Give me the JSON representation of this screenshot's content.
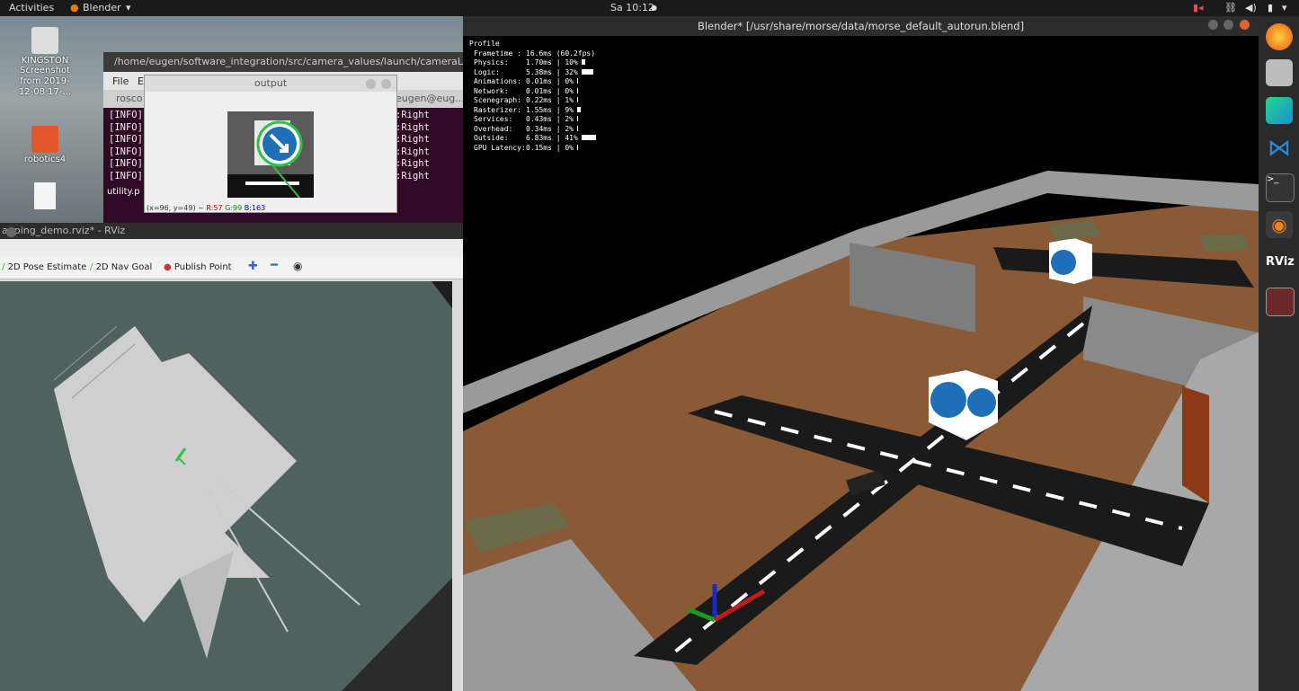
{
  "topbar": {
    "activities": "Activities",
    "app_name": "Blender",
    "clock": "Sa 10:12"
  },
  "desktop": {
    "icons": [
      {
        "label": "KINGSTON"
      },
      {
        "label": "Screenshot from 2019-12-08 17-..."
      },
      {
        "label": "robotics4"
      }
    ]
  },
  "terminal": {
    "title": "/home/eugen/software_integration/src/camera_values/launch/cameraL.l",
    "menu_file": "File",
    "menu_edit": "E",
    "tab_left": "rosco",
    "tab_right": "eugen@eug...",
    "behind_label": "utility.p",
    "log_prefix": [
      "[INFO]",
      "[INFO]",
      "[INFO]",
      "[INFO]",
      "[INFO]",
      "[INFO]"
    ],
    "log_suffix": [
      ":Right",
      ":Right",
      ":Right",
      ":Right",
      ":Right",
      ":Right"
    ]
  },
  "output_window": {
    "title": "output",
    "pixel_info_prefix": "(x=96, y=49) ~ ",
    "pixel_r": "R:57",
    "pixel_g": "G:99",
    "pixel_b": "B:163"
  },
  "rviz": {
    "title": "apping_demo.rviz* - RViz",
    "tools": [
      {
        "label": "2D Pose Estimate"
      },
      {
        "label": "2D Nav Goal"
      },
      {
        "label": "Publish Point"
      }
    ]
  },
  "blender": {
    "title": "Blender* [/usr/share/morse/data/morse_default_autorun.blend]",
    "profile_title": "Profile",
    "profile_rows": [
      {
        "name": "Frametime :",
        "value": "16.6ms (60.2fps)",
        "pct": ""
      },
      {
        "name": "Physics:",
        "value": "1.70ms",
        "pct": "10%"
      },
      {
        "name": "Logic:",
        "value": "5.38ms",
        "pct": "32%"
      },
      {
        "name": "Animations:",
        "value": "0.01ms",
        "pct": "0%"
      },
      {
        "name": "Network:",
        "value": "0.01ms",
        "pct": "0%"
      },
      {
        "name": "Scenegraph:",
        "value": "0.22ms",
        "pct": "1%"
      },
      {
        "name": "Rasterizer:",
        "value": "1.55ms",
        "pct": "9%"
      },
      {
        "name": "Services:",
        "value": "0.43ms",
        "pct": "2%"
      },
      {
        "name": "Overhead:",
        "value": "0.34ms",
        "pct": "2%"
      },
      {
        "name": "Outside:",
        "value": "6.83ms",
        "pct": "41%"
      },
      {
        "name": "GPU Latency:",
        "value": "0.15ms",
        "pct": "0%"
      }
    ]
  },
  "dock": {
    "icons": [
      "firefox-icon",
      "files-icon",
      "pycharm-icon",
      "vscode-icon",
      "terminal-icon",
      "blender-icon",
      "rviz-icon",
      "record-icon"
    ]
  },
  "colors": {
    "terminal_bg": "#300a24",
    "rviz_bg": "#4f625e",
    "floor": "#8a5a36",
    "road": "#1a1a1a",
    "sign_blue": "#1e6fb8"
  }
}
